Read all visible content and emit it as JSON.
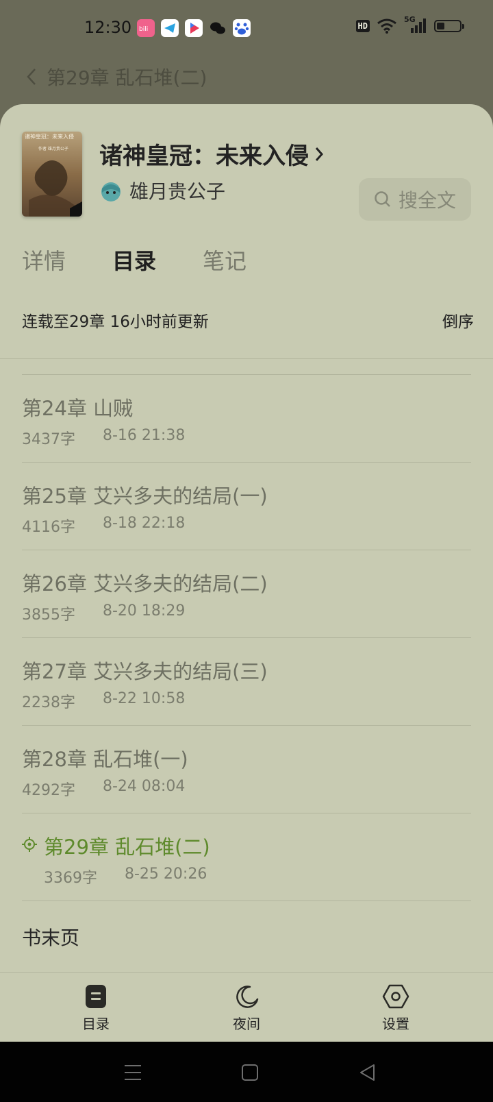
{
  "status_bar": {
    "time": "12:30",
    "apps": [
      "bilibili-icon",
      "telegram-icon",
      "video-app-icon",
      "wechat-icon",
      "baidu-icon"
    ],
    "hd": "HD",
    "network": "5G",
    "battery_level": 0.35
  },
  "reader": {
    "current_chapter": "第29章 乱石堆(二)"
  },
  "book": {
    "title": "诸神皇冠：未来入侵",
    "author": "雄月贵公子",
    "cover_title": "诸神皇冠：未来入侵",
    "cover_author": "作者 雄月贵公子"
  },
  "search_label": "搜全文",
  "tabs": [
    {
      "label": "详情",
      "active": false
    },
    {
      "label": "目录",
      "active": true
    },
    {
      "label": "笔记",
      "active": false
    }
  ],
  "catalog": {
    "status": "连载至29章 16小时前更新",
    "sort_label": "倒序",
    "chapters": [
      {
        "title": "第24章 山贼",
        "words": "3437字",
        "date": "8-16 21:38"
      },
      {
        "title": "第25章 艾兴多夫的结局(一)",
        "words": "4116字",
        "date": "8-18 22:18"
      },
      {
        "title": "第26章 艾兴多夫的结局(二)",
        "words": "3855字",
        "date": "8-20 18:29"
      },
      {
        "title": "第27章 艾兴多夫的结局(三)",
        "words": "2238字",
        "date": "8-22 10:58"
      },
      {
        "title": "第28章 乱石堆(一)",
        "words": "4292字",
        "date": "8-24 08:04"
      },
      {
        "title": "第29章 乱石堆(二)",
        "words": "3369字",
        "date": "8-25 20:26",
        "current": true
      }
    ],
    "end_label": "书末页"
  },
  "bottom_nav": [
    {
      "label": "目录",
      "icon": "catalog-icon"
    },
    {
      "label": "夜间",
      "icon": "moon-icon"
    },
    {
      "label": "设置",
      "icon": "settings-hexagon-icon"
    }
  ],
  "colors": {
    "sheet_bg": "#c8cbb2",
    "accent_green": "#5e8a2c",
    "backdrop": "#6a6a58"
  }
}
